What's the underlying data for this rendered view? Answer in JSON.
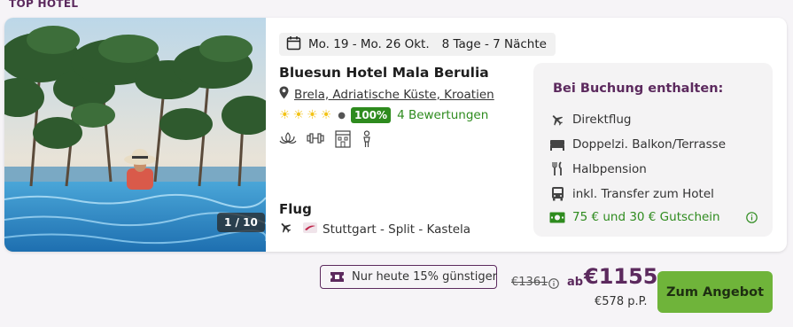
{
  "section_label": "TOP HOTEL",
  "gallery": {
    "counter": "1 / 10"
  },
  "offer": {
    "dates": "Mo. 19 - Mo. 26 Okt.",
    "duration": "8 Tage - 7 Nächte",
    "hotel_name": "Bluesun Hotel Mala Berulia",
    "location": "Brela, Adriatische Küste, Kroatien",
    "stars": 4,
    "score": "100%",
    "reviews": "4 Bewertungen",
    "amenities": [
      "lotus-icon",
      "dumbbell-icon",
      "kids-club-icon",
      "child-icon"
    ]
  },
  "flight": {
    "title": "Flug",
    "route": "Stuttgart - Split - Kastela"
  },
  "included": {
    "title": "Bei Buchung enthalten:",
    "items": [
      {
        "icon": "plane-icon",
        "label": "Direktflug"
      },
      {
        "icon": "bed-icon",
        "label": "Doppelzi. Balkon/Terrasse"
      },
      {
        "icon": "cutlery-icon",
        "label": "Halbpension"
      },
      {
        "icon": "bus-icon",
        "label": "inkl. Transfer zum Hotel"
      },
      {
        "icon": "cash-icon",
        "label": "75 € und 30 € Gutschein"
      }
    ]
  },
  "pricing": {
    "promo": "Nur heute 15% günstiger",
    "old_price": "€1361",
    "ab": "ab",
    "price": "€1155",
    "per_person": "€578 p.P.",
    "cta": "Zum Angebot"
  },
  "colors": {
    "brand": "#5c2a5e",
    "green": "#2e8b1e",
    "cta": "#6fb43a",
    "star": "#f3c316"
  }
}
